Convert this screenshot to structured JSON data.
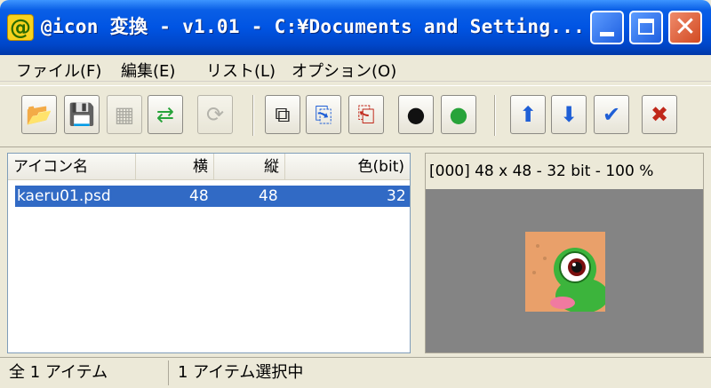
{
  "window": {
    "icon_glyph": "@",
    "title": "@icon 変換 - v1.01 - C:¥Documents and Setting..."
  },
  "menu": {
    "items": [
      {
        "label": "ファイル(F)"
      },
      {
        "label": "編集(E)"
      },
      {
        "label": "リスト(L)"
      },
      {
        "label": "オプション(O)"
      }
    ]
  },
  "toolbar": {
    "buttons": [
      {
        "icon": "open-folder-icon",
        "glyph": "📂"
      },
      {
        "icon": "save-icon",
        "glyph": "💾"
      },
      {
        "icon": "save-all-icon",
        "glyph": "▦"
      },
      {
        "icon": "convert-icon",
        "glyph": "⇄"
      },
      {
        "icon": "refresh-icon",
        "glyph": "⟳"
      },
      {
        "icon": "copy-icon",
        "glyph": "⧉"
      },
      {
        "icon": "export-icon",
        "glyph": "⎘"
      },
      {
        "icon": "import-icon",
        "glyph": "⎗"
      },
      {
        "icon": "user-black-icon",
        "glyph": "●"
      },
      {
        "icon": "user-green-icon",
        "glyph": "●"
      },
      {
        "icon": "arrow-up-icon",
        "glyph": "⬆"
      },
      {
        "icon": "arrow-down-icon",
        "glyph": "⬇"
      },
      {
        "icon": "check-icon",
        "glyph": "✔"
      },
      {
        "icon": "delete-icon",
        "glyph": "✖"
      }
    ],
    "colors": {
      "blue": "#1f5fd6",
      "green": "#27a33a",
      "red": "#c0281a"
    }
  },
  "list": {
    "columns": [
      "アイコン名",
      "横",
      "縦",
      "色(bit)"
    ],
    "rows": [
      {
        "name": "kaeru01.psd",
        "width": "48",
        "height": "48",
        "bits": "32"
      }
    ],
    "selection_color": "#316ac5"
  },
  "preview": {
    "info": "[000] 48 x 48 - 32 bit - 100 %",
    "background": "#848484"
  },
  "status": {
    "total": "全 1 アイテム",
    "selected": "1 アイテム選択中"
  }
}
